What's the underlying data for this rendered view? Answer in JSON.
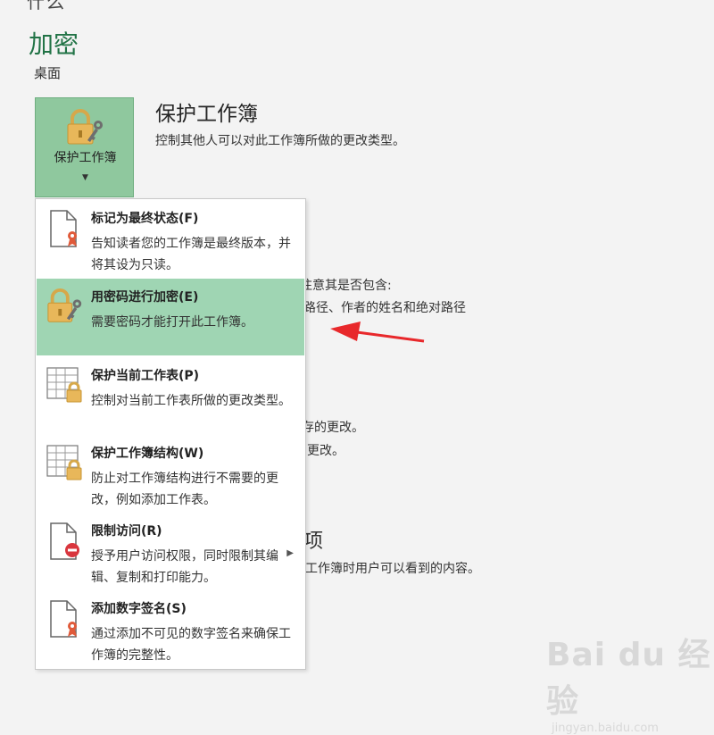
{
  "header": {
    "top_fragment": "什么",
    "title": "加密",
    "location": "桌面"
  },
  "protect_workbook": {
    "button_label": "保护工作簿",
    "title": "保护工作簿",
    "description": "控制其他人可以对此工作簿所做的更改类型。"
  },
  "background": {
    "line1": "注意其是否包含:",
    "line2": "路径、作者的姓名和绝对路径",
    "line3": "存的更改。",
    "line4": "更改。",
    "line5": "项",
    "line6": "工作簿时用户可以看到的内容。"
  },
  "menu": {
    "items": [
      {
        "title": "标记为最终状态(F)",
        "desc": "告知读者您的工作簿是最终版本，并将其设为只读。",
        "icon": "final-document-icon"
      },
      {
        "title": "用密码进行加密(E)",
        "desc": "需要密码才能打开此工作簿。",
        "icon": "lock-key-icon"
      },
      {
        "title": "保护当前工作表(P)",
        "desc": "控制对当前工作表所做的更改类型。",
        "icon": "sheet-lock-icon"
      },
      {
        "title": "保护工作簿结构(W)",
        "desc": "防止对工作簿结构进行不需要的更改，例如添加工作表。",
        "icon": "workbook-structure-lock-icon"
      },
      {
        "title": "限制访问(R)",
        "desc": "授予用户访问权限，同时限制其编辑、复制和打印能力。",
        "icon": "restrict-access-icon"
      },
      {
        "title": "添加数字签名(S)",
        "desc": "通过添加不可见的数字签名来确保工作簿的完整性。",
        "icon": "digital-signature-icon"
      }
    ]
  },
  "watermark": {
    "brand": "Bai du 经验",
    "url": "jingyan.baidu.com"
  },
  "colors": {
    "accent_green": "#217346",
    "button_bg": "#8fc89e",
    "highlight_bg": "#9fd5b3",
    "arrow_red": "#e8282b"
  }
}
